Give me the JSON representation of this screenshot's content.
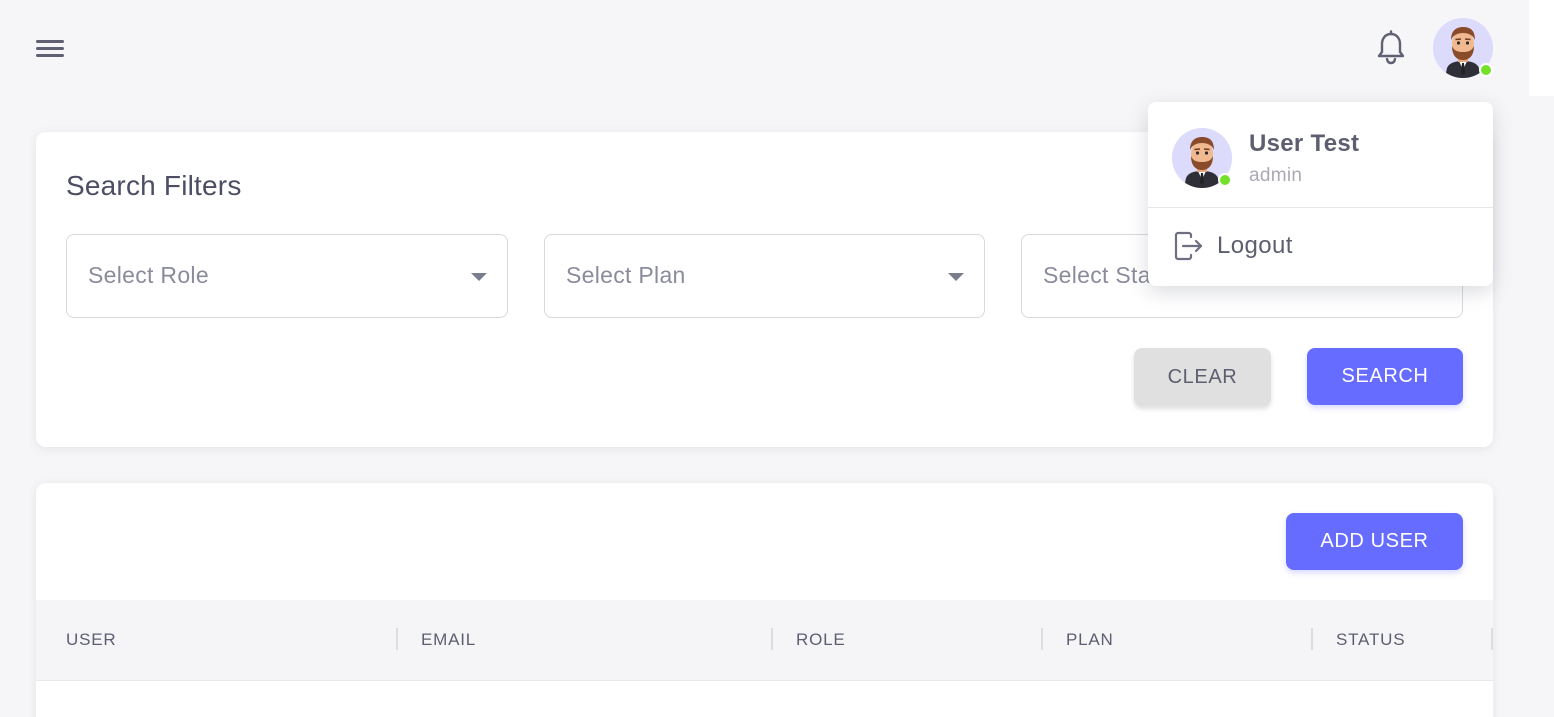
{
  "header": {
    "menu_icon": "hamburger-menu-icon",
    "notification_icon": "bell-icon",
    "avatar_status_color": "#72e128"
  },
  "filters": {
    "title": "Search Filters",
    "role_select": "Select Role",
    "plan_select": "Select Plan",
    "status_select": "Select Status",
    "clear_label": "CLEAR",
    "search_label": "SEARCH"
  },
  "table": {
    "add_user_label": "ADD USER",
    "columns": [
      "USER",
      "EMAIL",
      "ROLE",
      "PLAN",
      "STATUS"
    ]
  },
  "user_menu": {
    "name": "User Test",
    "role": "admin",
    "logout_label": "Logout"
  },
  "colors": {
    "primary": "#666cff",
    "background": "#f6f6f8",
    "online": "#72e128"
  }
}
